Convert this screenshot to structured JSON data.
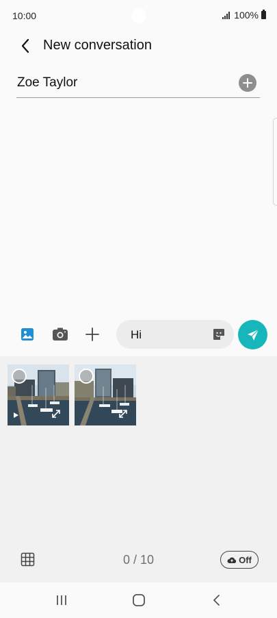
{
  "status_bar": {
    "time": "10:00",
    "battery": "100%"
  },
  "header": {
    "title": "New conversation",
    "back_icon": "chevron-left-icon"
  },
  "recipient": {
    "name": "Zoe Taylor",
    "add_icon": "plus-circle-icon"
  },
  "composer": {
    "tools": [
      "gallery-icon",
      "camera-icon",
      "plus-icon"
    ],
    "message_value": "Hi",
    "sticker_icon": "sticker-icon",
    "send_icon": "send-icon",
    "send_color": "#17b6bb"
  },
  "gallery": {
    "thumbnails": [
      {
        "kind": "video",
        "content": "harbour with modern buildings and yachts"
      },
      {
        "kind": "image",
        "content": "harbour with modern buildings and yachts"
      }
    ],
    "selection_count": "0 / 10",
    "cloud_toggle": "Off"
  },
  "nav_bar": {
    "buttons": [
      "recent-apps-icon",
      "home-icon",
      "back-icon"
    ]
  }
}
